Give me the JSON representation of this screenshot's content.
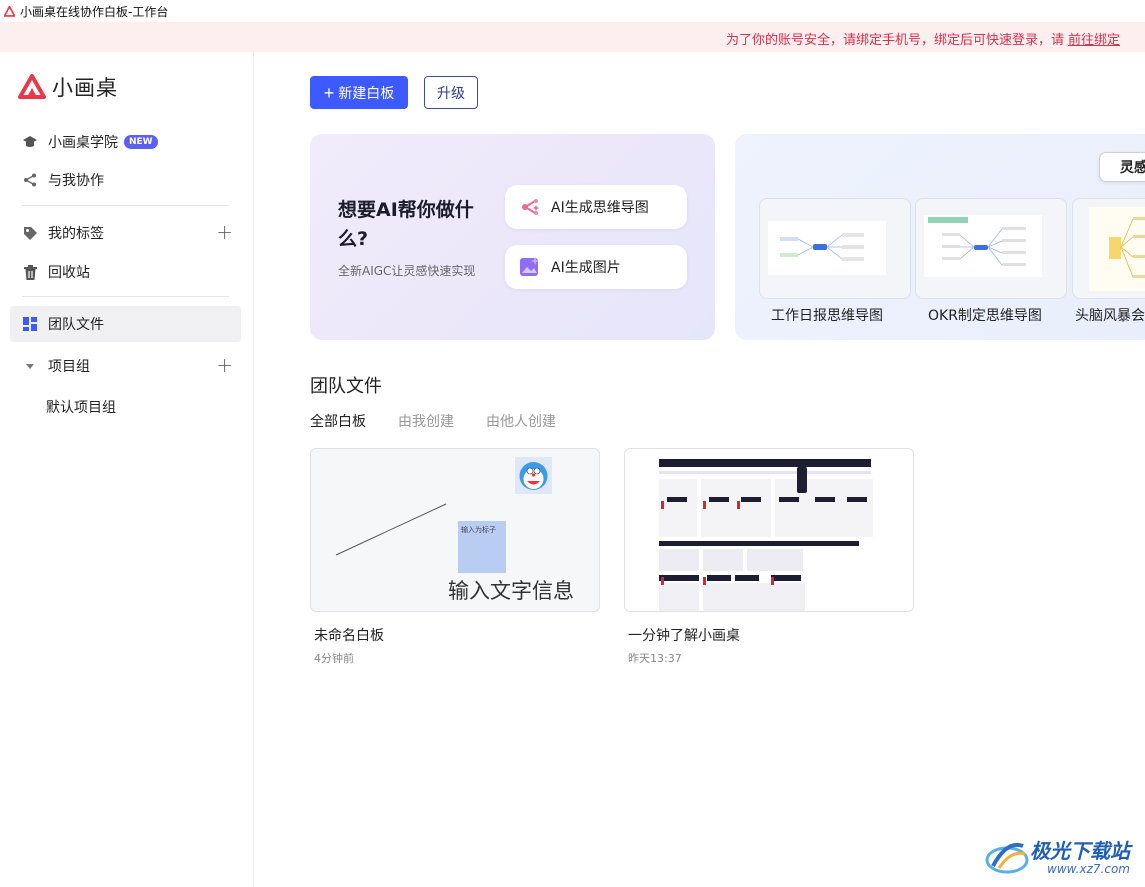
{
  "window": {
    "title": "小画桌在线协作白板-工作台"
  },
  "banner": {
    "text": "为了你的账号安全，请绑定手机号，绑定后可快速登录，请",
    "link": "前往绑定"
  },
  "brand": {
    "name": "小画桌",
    "color": "#e8394a"
  },
  "sidebar": {
    "academy": "小画桌学院",
    "new_badge": "NEW",
    "collab": "与我协作",
    "tags": "我的标签",
    "trash": "回收站",
    "team_files": "团队文件",
    "project_group": "项目组",
    "default_project": "默认项目组"
  },
  "toolbar": {
    "new_board": "新建白板",
    "upgrade": "升级"
  },
  "ai": {
    "title": "想要AI帮你做什么?",
    "subtitle": "全新AIGC让灵感快速实现",
    "mindmap_btn": "AI生成思维导图",
    "image_btn": "AI生成图片"
  },
  "templates": {
    "inspiration_tab": "灵感",
    "items": [
      {
        "label": "工作日报思维导图"
      },
      {
        "label": "OKR制定思维导图"
      },
      {
        "label": "头脑风暴会"
      }
    ]
  },
  "files_section": {
    "title": "团队文件",
    "tabs": [
      "全部白板",
      "由我创建",
      "由他人创建"
    ],
    "active_tab": 0
  },
  "files": [
    {
      "name": "未命名白板",
      "time": "4分钟前",
      "sticky_text": "输入为标子",
      "big_text": "输入文字信息"
    },
    {
      "name": "一分钟了解小画桌",
      "time": "昨天13:37"
    }
  ],
  "watermark": {
    "text": "极光下载站",
    "url": "www.xz7.com"
  },
  "colors": {
    "primary": "#3d5afe",
    "badge": "#5b5ff2",
    "banner_text": "#d8314a"
  }
}
